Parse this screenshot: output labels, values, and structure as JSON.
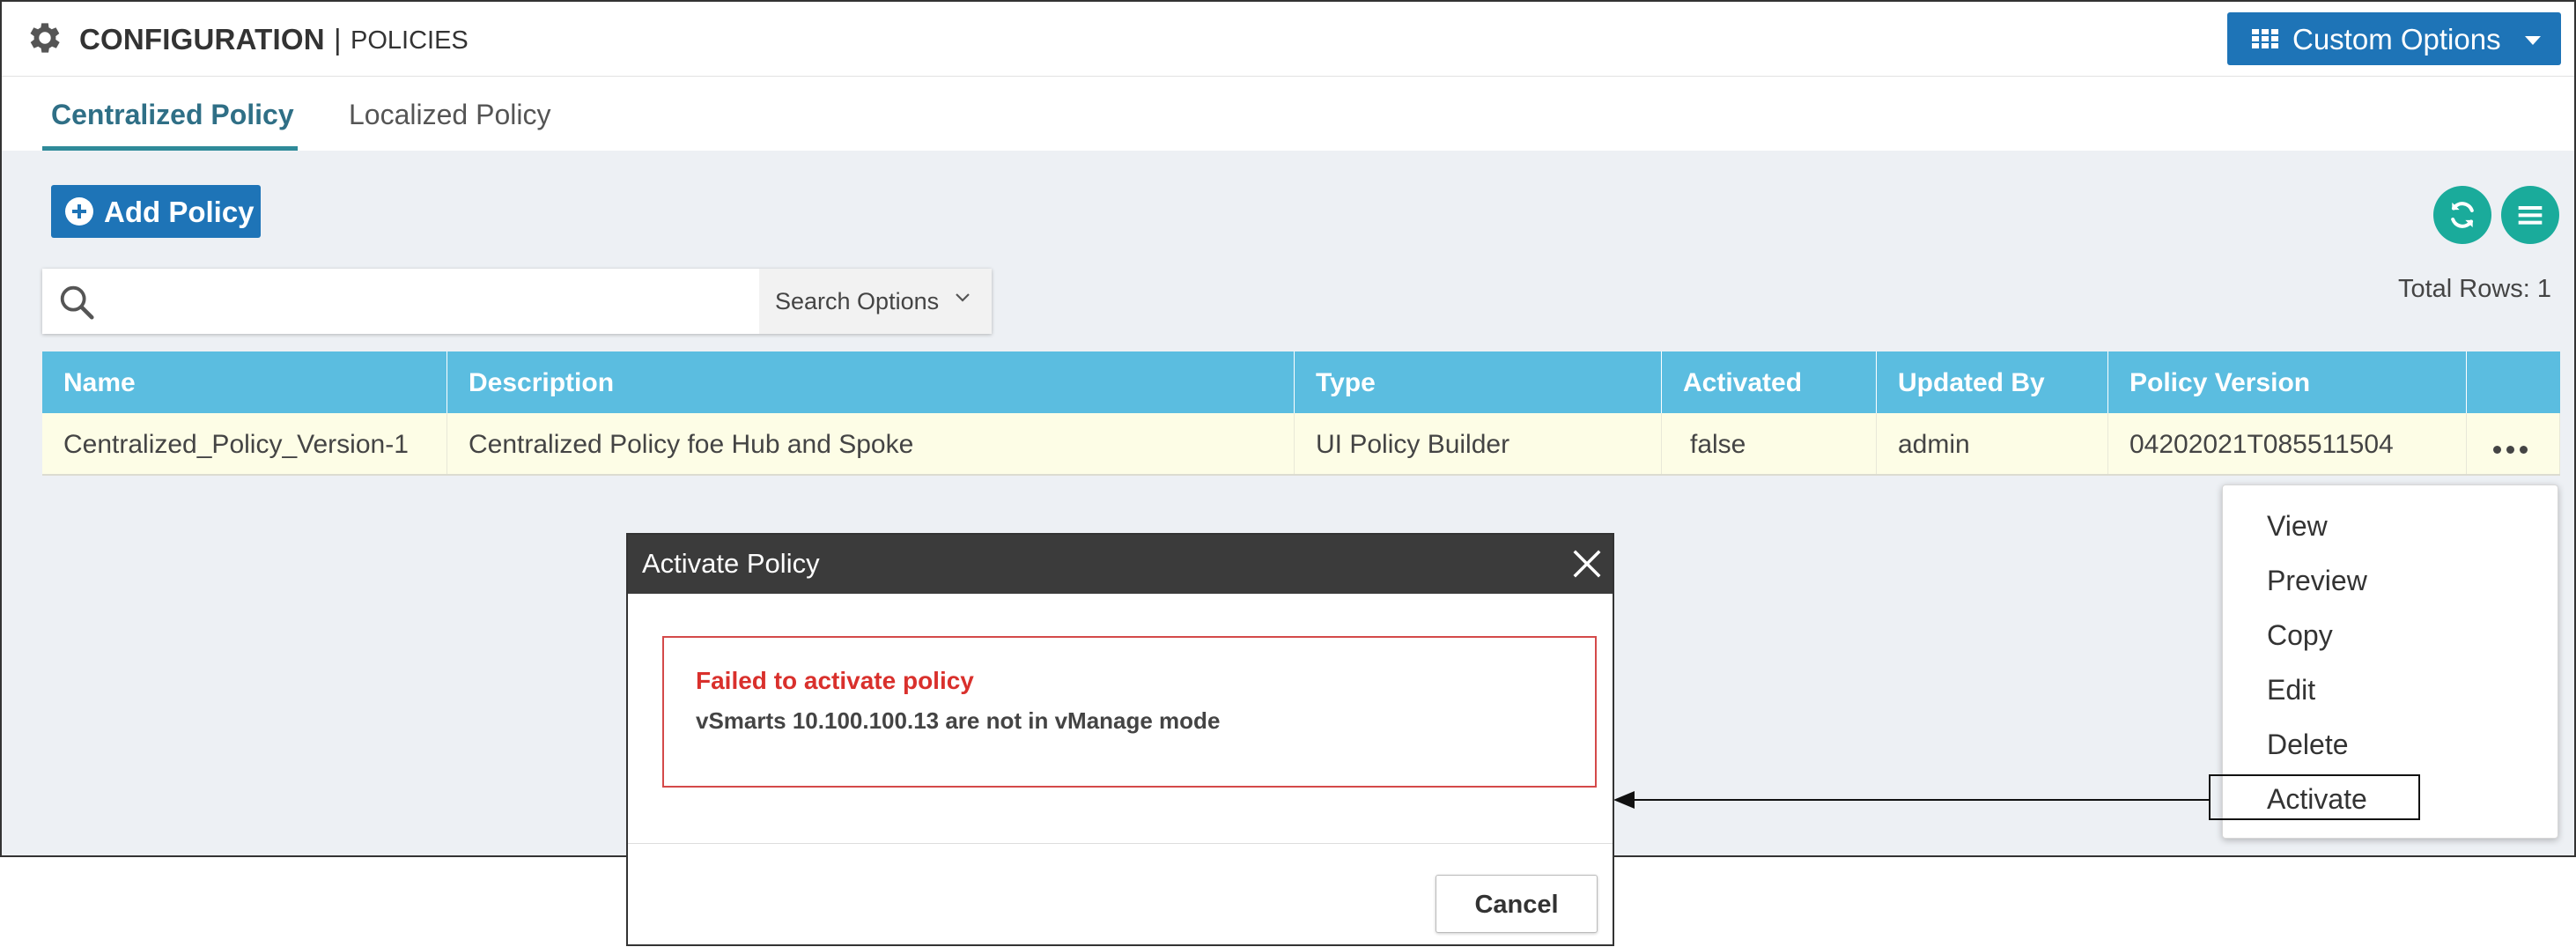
{
  "header": {
    "title": "CONFIGURATION",
    "separator": "|",
    "subtitle": "POLICIES",
    "custom_options_label": "Custom Options"
  },
  "tabs": [
    {
      "label": "Centralized Policy",
      "active": true
    },
    {
      "label": "Localized Policy",
      "active": false
    }
  ],
  "toolbar": {
    "add_policy_label": "Add Policy",
    "search_placeholder": "",
    "search_options_label": "Search Options",
    "total_rows_label": "Total Rows:",
    "total_rows_value": "1"
  },
  "table": {
    "columns": [
      "Name",
      "Description",
      "Type",
      "Activated",
      "Updated By",
      "Policy Version",
      ""
    ],
    "rows": [
      {
        "name": "Centralized_Policy_Version-1",
        "description": "Centralized Policy foe Hub and Spoke",
        "type": "UI Policy Builder",
        "activated": "false",
        "updated_by": "admin",
        "policy_version": "04202021T085511504"
      }
    ]
  },
  "context_menu": {
    "items": [
      "View",
      "Preview",
      "Copy",
      "Edit",
      "Delete",
      "Activate"
    ],
    "highlighted": "Activate"
  },
  "modal": {
    "title": "Activate Policy",
    "error_title": "Failed to activate policy",
    "error_message": "vSmarts 10.100.100.13 are not in vManage mode",
    "cancel_label": "Cancel"
  },
  "colors": {
    "primary_blue": "#1e74b7",
    "table_header": "#5bbde0",
    "row_highlight": "#fdfde6",
    "teal_button": "#1aab9b",
    "error_red": "#d9302c",
    "modal_header": "#3b3b3b"
  },
  "icons": [
    "gear-icon",
    "grid-icon",
    "caret-down-icon",
    "plus-circle-icon",
    "refresh-icon",
    "menu-icon",
    "search-icon",
    "chevron-down-icon",
    "more-icon",
    "close-icon",
    "arrow-left-icon"
  ]
}
